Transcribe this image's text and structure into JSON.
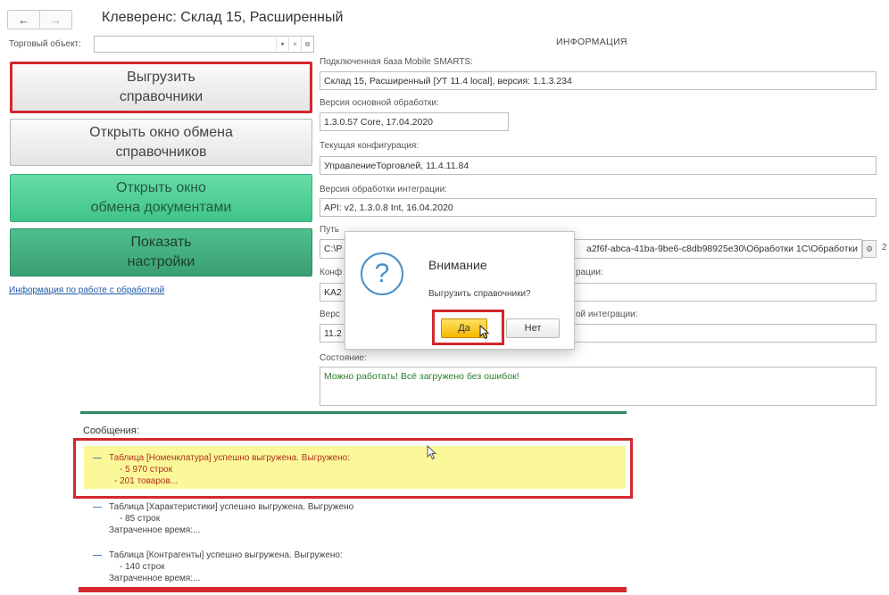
{
  "nav": {
    "back": "←",
    "forward": "→"
  },
  "window_title": "Клеверенс: Склад 15, Расширенный",
  "trade_object": {
    "label": "Торговый объект:",
    "value": "",
    "btn_dropdown": "▾",
    "btn_clear": "×",
    "btn_open": "⧉"
  },
  "buttons": {
    "upload": [
      "Выгрузить",
      "справочники"
    ],
    "open_dict_exchange": [
      "Открыть окно обмена",
      "справочников"
    ],
    "open_doc_exchange": [
      "Открыть окно",
      "обмена документами"
    ],
    "show_settings": [
      "Показать",
      "настройки"
    ]
  },
  "info_link": "Информация по работе с обработкой",
  "info": {
    "title": "ИНФОРМАЦИЯ",
    "db_label": "Подключенная база Mobile SMARTS:",
    "db_value": "Склад 15, Расширенный [УТ 11.4 local], версия: 1.1.3.234",
    "core_label": "Версия основной обработки:",
    "core_value": "1.3.0.57 Core, 17.04.2020",
    "config_label": "Текущая конфигурация:",
    "config_value": "УправлениеТорговлей, 11.4.11.84",
    "integ_label": "Версия обработки интеграции:",
    "integ_value": "API: v2, 1.3.0.8 Int, 16.04.2020",
    "path_label_left": "Путь",
    "path_value_left": "C:\\P",
    "path_value_right": "a2f6f-abca-41ba-9be6-c8db98925e30\\Обработки 1C\\Обработки",
    "path_extra": "2",
    "conf_label_left": "Конф",
    "conf_label_right": "рации:",
    "conf_value_left": "KA2",
    "ver_label_left": "Верс",
    "ver_label_right": "ой интеграции:",
    "ver_value_left": "11.2",
    "state_label": "Состояние:",
    "state_value": "Можно работать! Всё загружено без ошибок!"
  },
  "dialog": {
    "icon": "?",
    "title": "Внимание",
    "message": "Выгрузить справочники?",
    "yes": "Да",
    "no": "Нет"
  },
  "messages": {
    "title": "Сообщения:",
    "items": [
      {
        "lines": [
          "Таблица [Номенклатура] успешно выгружена. Выгружено:",
          "- 5 970 строк",
          "- 201 товаров..."
        ]
      },
      {
        "lines": [
          "Таблица [Характеристики] успешно выгружена. Выгружено",
          "- 85 строк",
          "Затраченное время:..."
        ]
      },
      {
        "lines": [
          "Таблица [Контрагенты] успешно выгружена. Выгружено:",
          "- 140 строк",
          "Затраченное время:..."
        ]
      }
    ]
  },
  "colors": {
    "accent_red": "#d2282e",
    "green": "#40c489",
    "dark_green": "#3a9f72",
    "dialog_yes": "#f5b800"
  }
}
